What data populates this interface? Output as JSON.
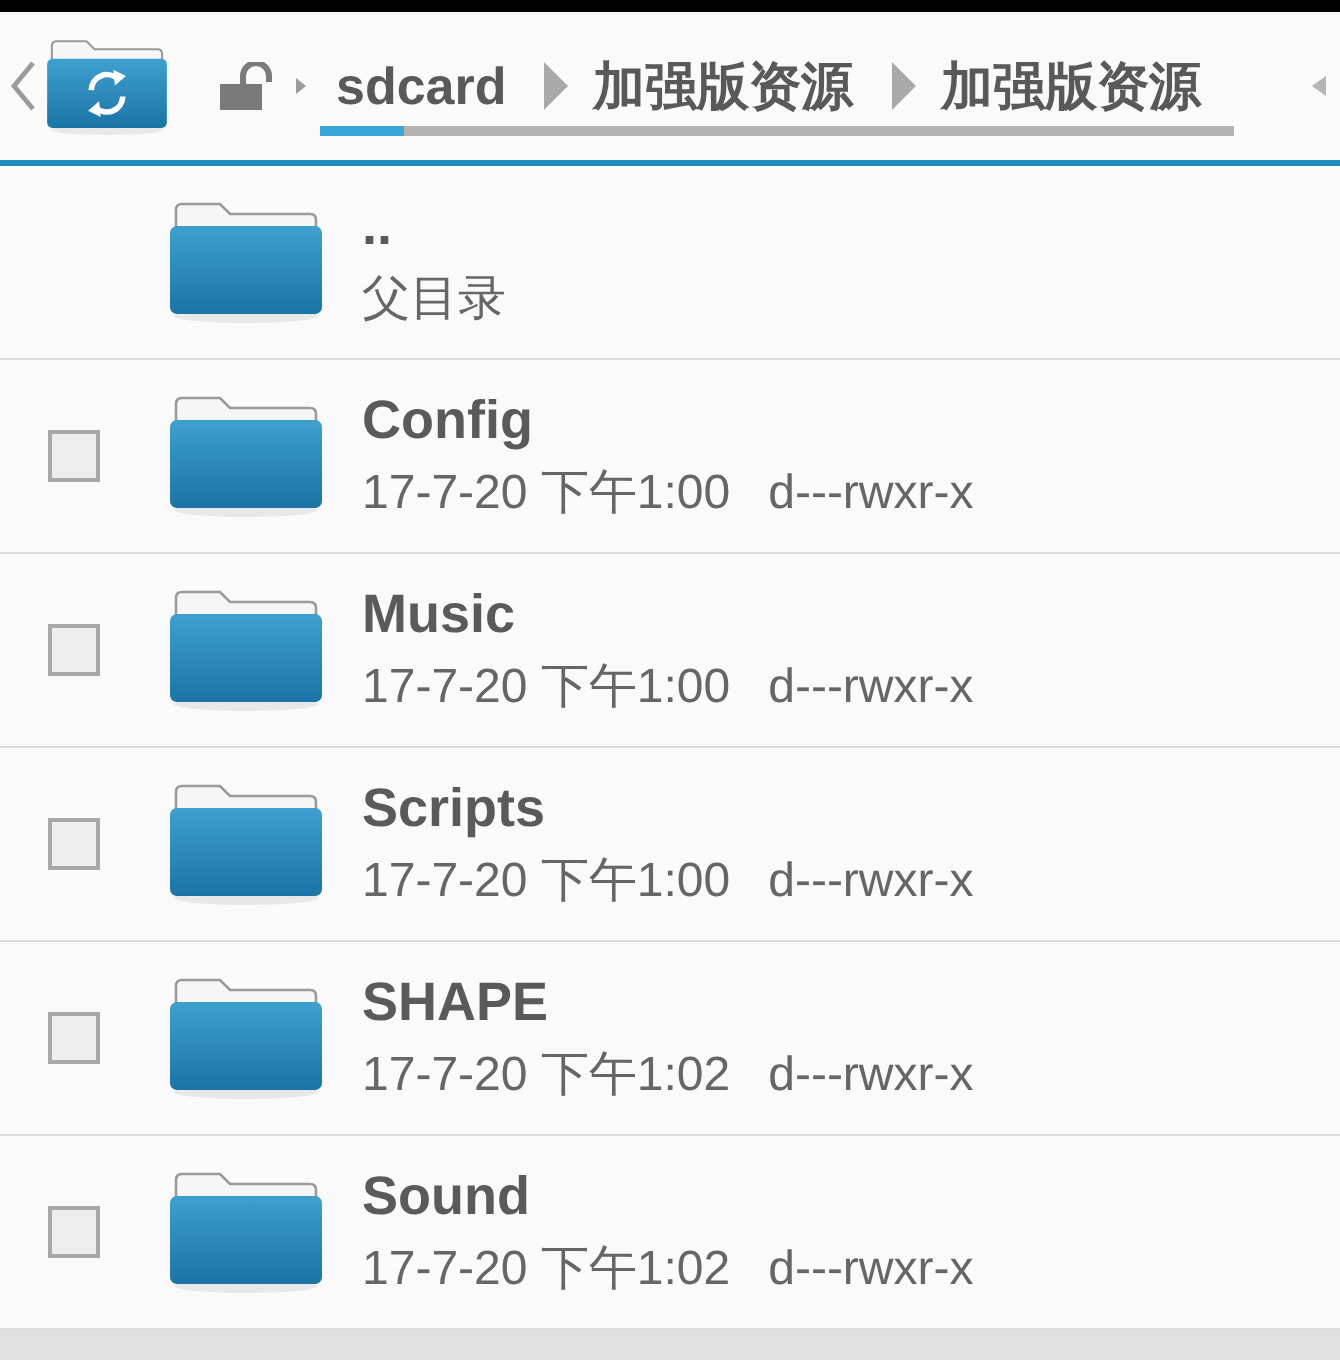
{
  "toolbar": {
    "breadcrumb": [
      {
        "label": "sdcard"
      },
      {
        "label": "加强版资源"
      },
      {
        "label": "加强版资源"
      }
    ]
  },
  "entries": [
    {
      "kind": "parent",
      "name": "..",
      "detail": "父目录"
    },
    {
      "kind": "folder",
      "name": "Config",
      "date": "17-7-20 下午1:00",
      "permissions": "d---rwxr-x",
      "checked": false
    },
    {
      "kind": "folder",
      "name": "Music",
      "date": "17-7-20 下午1:00",
      "permissions": "d---rwxr-x",
      "checked": false
    },
    {
      "kind": "folder",
      "name": "Scripts",
      "date": "17-7-20 下午1:00",
      "permissions": "d---rwxr-x",
      "checked": false
    },
    {
      "kind": "folder",
      "name": "SHAPE",
      "date": "17-7-20 下午1:02",
      "permissions": "d---rwxr-x",
      "checked": false
    },
    {
      "kind": "folder",
      "name": "Sound",
      "date": "17-7-20 下午1:02",
      "permissions": "d---rwxr-x",
      "checked": false
    }
  ]
}
